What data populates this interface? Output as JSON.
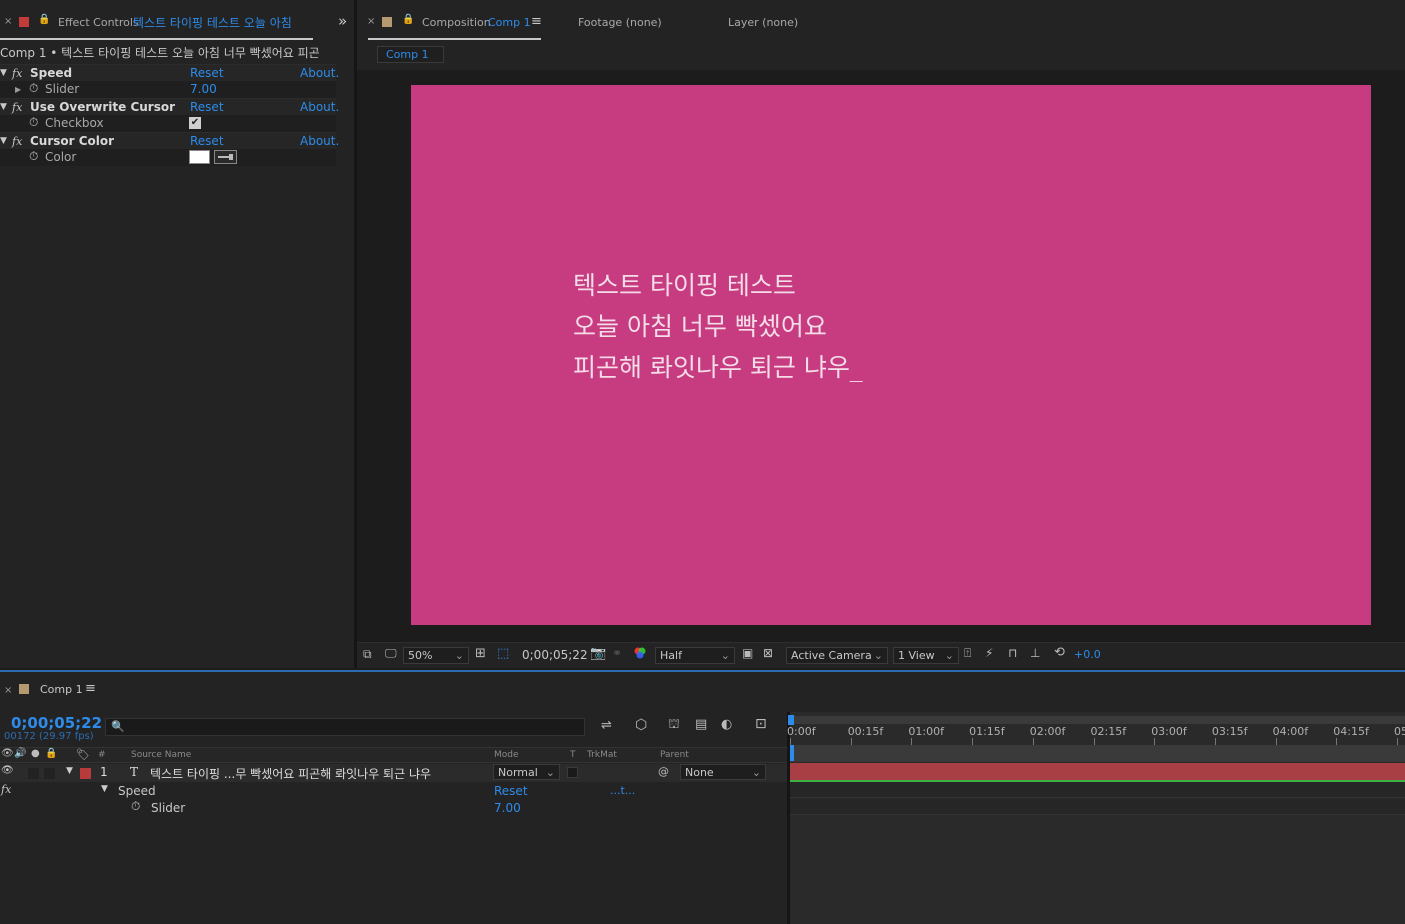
{
  "effect_controls": {
    "tab_prefix": "Effect Controls",
    "tab_layer": "텍스트 타이핑 테스트 오늘 아침",
    "expand_glyph": "»",
    "breadcrumb": "Comp 1 • 텍스트 타이핑 테스트 오늘 아침 너무 빡셌어요 피곤",
    "effects": [
      {
        "name": "Speed",
        "reset": "Reset",
        "about": "About.",
        "param_label": "Slider",
        "param_value": "7.00"
      },
      {
        "name": "Use Overwrite Cursor",
        "reset": "Reset",
        "about": "About.",
        "param_label": "Checkbox",
        "param_value": "✔"
      },
      {
        "name": "Cursor Color",
        "reset": "Reset",
        "about": "About.",
        "param_label": "Color",
        "param_value": ""
      }
    ],
    "fx_glyph": "fx"
  },
  "composition": {
    "tab_prefix": "Composition",
    "tab_comp": "Comp 1",
    "footage_tab": "Footage (none)",
    "layer_tab": "Layer (none)",
    "subtab": "Comp 1",
    "canvas_lines": [
      "텍스트 타이핑 테스트",
      "오늘 아침 너무 빡셌어요",
      "피곤해 롸잇나우 퇴근 냐우_"
    ],
    "canvas_color": "#c73c80"
  },
  "viewer_bar": {
    "zoom": "50%",
    "timecode": "0;00;05;22",
    "resolution": "Half",
    "camera": "Active Camera",
    "views": "1 View",
    "exposure": "+0.0"
  },
  "timeline": {
    "tab": "Comp 1",
    "timecode": "0;00;05;22",
    "frame_info": "00172 (29.97 fps)",
    "search_placeholder": "",
    "columns": {
      "num": "#",
      "source": "Source Name",
      "mode": "Mode",
      "t": "T",
      "trkmat": "TrkMat",
      "parent": "Parent"
    },
    "layer": {
      "index": "1",
      "type_glyph": "T",
      "name": "텍스트 타이핑 ...무 빡셌어요 피곤해 롸잇나우 퇴근 냐우",
      "mode": "Normal",
      "parent": "None"
    },
    "effect_row": {
      "fx": "fx",
      "name": "Speed",
      "reset": "Reset",
      "link": "...t..."
    },
    "param_row": {
      "name": "Slider",
      "value": "7.00"
    },
    "ruler": [
      "0:00f",
      "00:15f",
      "01:00f",
      "01:15f",
      "02:00f",
      "02:15f",
      "03:00f",
      "03:15f",
      "04:00f",
      "04:15f",
      "05:"
    ],
    "label_color": "#b83a3a",
    "bar_color": "#a83f45"
  }
}
